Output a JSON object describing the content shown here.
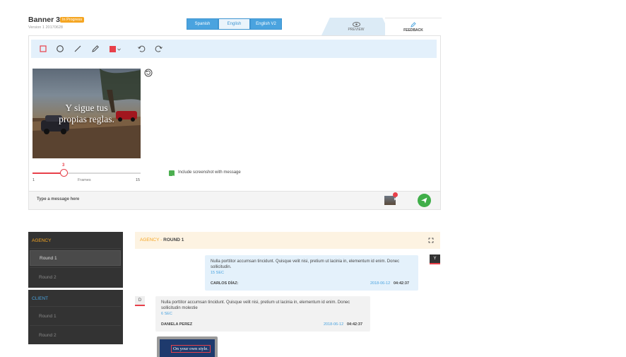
{
  "header": {
    "title": "Banner 3",
    "status_badge": "In Progress",
    "version": "Version 1 20170628",
    "languages": [
      "Spanish",
      "English",
      "English V2"
    ],
    "active_language": "English",
    "preview_label": "PREVIEW",
    "feedback_label": "FEEDBACK"
  },
  "toolbar": {
    "tools": [
      "square-icon",
      "circle-icon",
      "line-icon",
      "pencil-icon",
      "color-picker",
      "undo-icon",
      "redo-icon"
    ],
    "color": "#e8404a"
  },
  "banner": {
    "text_line1": "Y sigue tus",
    "text_line2": "propias reglas."
  },
  "slider": {
    "value": "3",
    "min": "1",
    "max": "15",
    "label": "Frames",
    "fraction": 0.143
  },
  "screenshot_option": {
    "label": "Include screenshot with message",
    "checked": true
  },
  "message": {
    "placeholder": "Type a message here"
  },
  "sidebar": {
    "agency": {
      "heading": "AGENCY",
      "items": [
        "Round 1",
        "Round 2"
      ],
      "active": "Round 1"
    },
    "client": {
      "heading": "CLIENT",
      "items": [
        "Round 1",
        "Round 2"
      ]
    }
  },
  "chat": {
    "title_prefix": "AGENCY",
    "title_sep": " - ",
    "title_rest": "ROUND 1",
    "messages": [
      {
        "text": "Nulla porttitor accumsan tincidunt. Quisque velit nisi, pretium ut lacinia in, elementum id enim. Donec sollicitudin.",
        "duration": "15 SEC",
        "author": "CARLOS DÍAZ:",
        "date": "2018-06-12",
        "time": "04:42:37",
        "avatar": "Y"
      },
      {
        "text": "Nulla porttitor accumsan tincidunt. Quisque velit nisi, pretium ut lacinia in, elementum id enim. Donec sollicitudin molestie",
        "duration": "6 SEC",
        "author": "DANIELA PEREZ",
        "date": "2018-06-12",
        "time": "04:42:37",
        "avatar": "D"
      }
    ],
    "attachment_caption": "On your own style."
  },
  "colors": {
    "accent_blue": "#4aa3df",
    "accent_red": "#e8404a",
    "agency_orange": "#f5a623",
    "send_green": "#3fae49",
    "sidebar_dark": "#333333"
  }
}
